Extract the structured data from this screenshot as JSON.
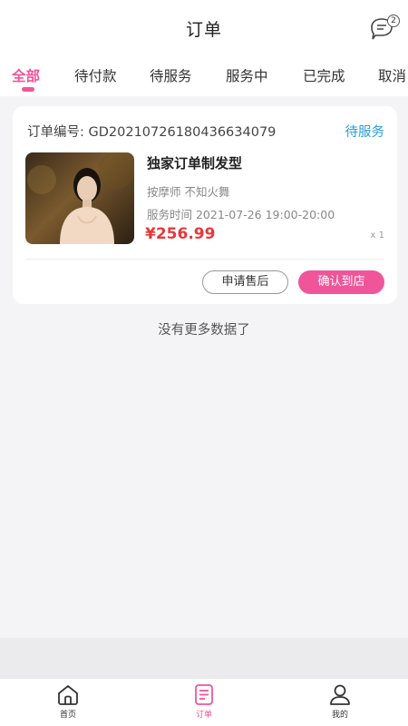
{
  "header": {
    "title": "订单",
    "message_count": "2"
  },
  "tabs": [
    {
      "label": "全部",
      "active": true
    },
    {
      "label": "待付款",
      "active": false
    },
    {
      "label": "待服务",
      "active": false
    },
    {
      "label": "服务中",
      "active": false
    },
    {
      "label": "已完成",
      "active": false
    },
    {
      "label": "取消",
      "active": false
    }
  ],
  "order": {
    "number_label": "订单编号: GD20210726180436634079",
    "status": "待服务",
    "product_name": "独家订单制发型",
    "therapist": "按摩师 不知火舞",
    "service_time": "服务时间 2021-07-26 19:00-20:00",
    "price": "¥256.99",
    "quantity": "x 1",
    "buttons": {
      "after_sale": "申请售后",
      "confirm": "确认到店"
    }
  },
  "list_footer": "没有更多数据了",
  "bottom_nav": [
    {
      "label": "首页",
      "icon": "home-icon",
      "active": false
    },
    {
      "label": "订单",
      "icon": "order-icon",
      "active": true
    },
    {
      "label": "我的",
      "icon": "user-icon",
      "active": false
    }
  ],
  "colors": {
    "accent": "#f0559a",
    "status_blue": "#2a9fd8",
    "price_red": "#e8373a"
  }
}
